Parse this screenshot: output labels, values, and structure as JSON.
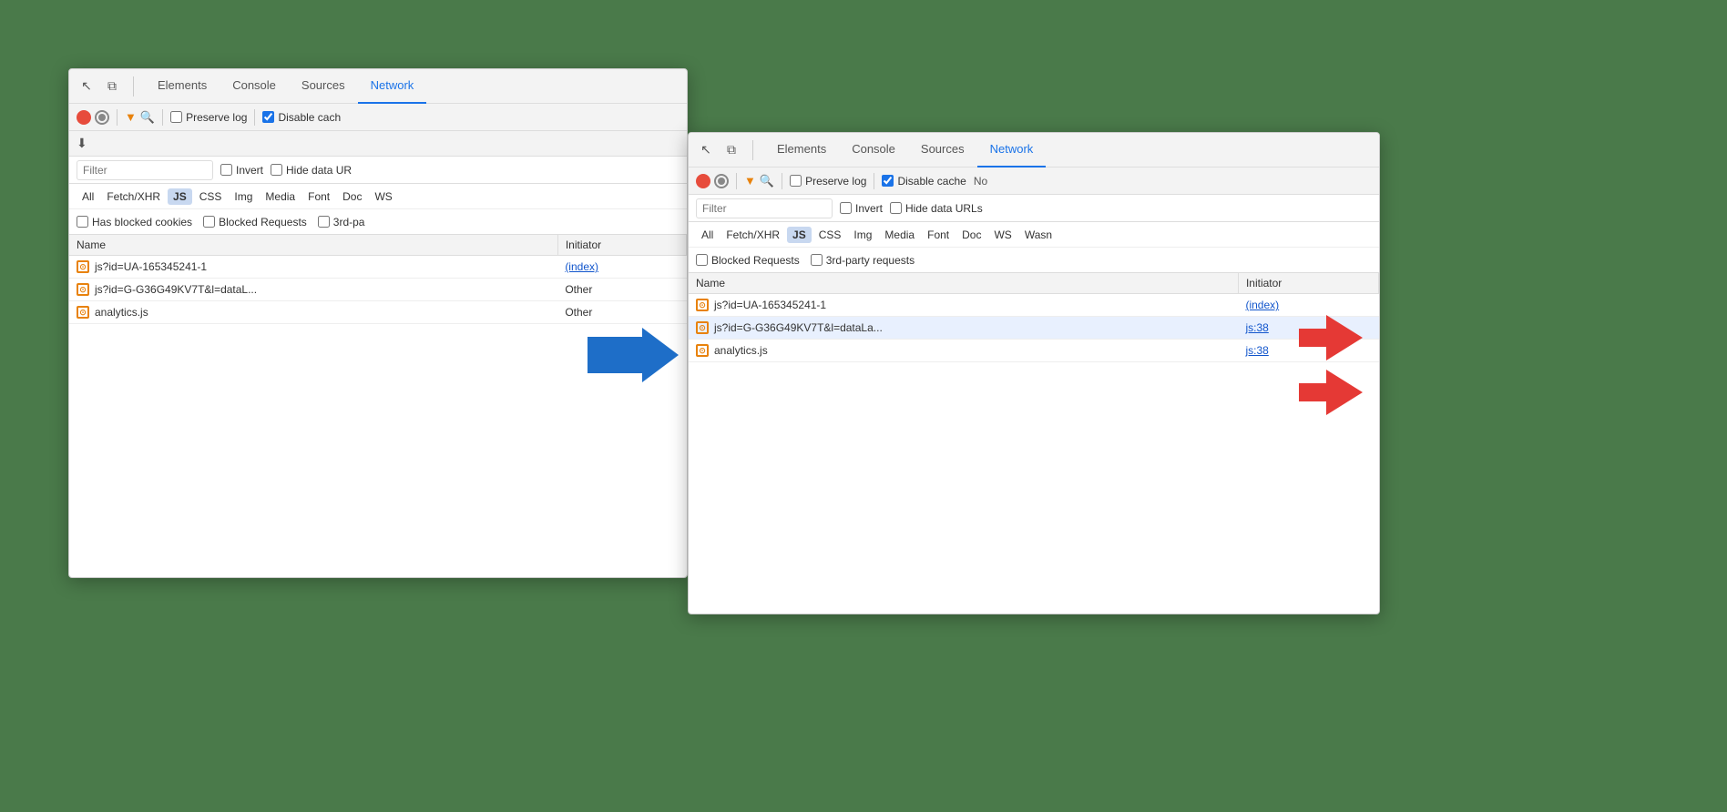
{
  "panel_left": {
    "tabs": [
      "Elements",
      "Console",
      "Sources",
      "Network"
    ],
    "active_tab": "Network",
    "toolbar": {
      "preserve_log_label": "Preserve log",
      "disable_cache_label": "Disable cach",
      "preserve_log_checked": false,
      "disable_cache_checked": true
    },
    "filter_placeholder": "Filter",
    "filter_options": [
      "Invert",
      "Hide data UR"
    ],
    "type_filters": [
      "All",
      "Fetch/XHR",
      "JS",
      "CSS",
      "Img",
      "Media",
      "Font",
      "Doc",
      "WS"
    ],
    "active_type": "JS",
    "extra_filters": [
      "Has blocked cookies",
      "Blocked Requests",
      "3rd-pa"
    ],
    "table": {
      "columns": [
        "Name",
        "Initiator"
      ],
      "rows": [
        {
          "icon": "⊙",
          "name": "js?id=UA-165345241-1",
          "initiator": "(index)",
          "initiator_link": true
        },
        {
          "icon": "⊙",
          "name": "js?id=G-G36G49KV7T&l=dataL...",
          "initiator": "Other",
          "initiator_link": false
        },
        {
          "icon": "⊙",
          "name": "analytics.js",
          "initiator": "Other",
          "initiator_link": false
        }
      ]
    }
  },
  "panel_right": {
    "tabs": [
      "Elements",
      "Console",
      "Sources",
      "Network"
    ],
    "active_tab": "Network",
    "toolbar": {
      "preserve_log_label": "Preserve log",
      "disable_cache_label": "Disable cache",
      "no_label": "No",
      "preserve_log_checked": false,
      "disable_cache_checked": true
    },
    "filter_placeholder": "Filter",
    "filter_options": [
      "Invert",
      "Hide data URLs"
    ],
    "type_filters": [
      "All",
      "Fetch/XHR",
      "JS",
      "CSS",
      "Img",
      "Media",
      "Font",
      "Doc",
      "WS",
      "Wasn"
    ],
    "active_type": "JS",
    "extra_filters": [
      "Blocked Requests",
      "3rd-party requests"
    ],
    "table": {
      "columns": [
        "Name",
        "Initiator"
      ],
      "rows": [
        {
          "icon": "⊙",
          "name": "js?id=UA-165345241-1",
          "initiator": "(index)",
          "initiator_link": true,
          "highlighted": false
        },
        {
          "icon": "⊙",
          "name": "js?id=G-G36G49KV7T&l=dataLa...",
          "initiator": "js:38",
          "initiator_link": true,
          "highlighted": true
        },
        {
          "icon": "⊙",
          "name": "analytics.js",
          "initiator": "js:38",
          "initiator_link": true,
          "highlighted": false
        }
      ]
    }
  },
  "icons": {
    "cursor": "↖",
    "layers": "⧉",
    "record": "●",
    "stop": "⊘",
    "filter": "▼",
    "search": "🔍",
    "download": "↓"
  }
}
